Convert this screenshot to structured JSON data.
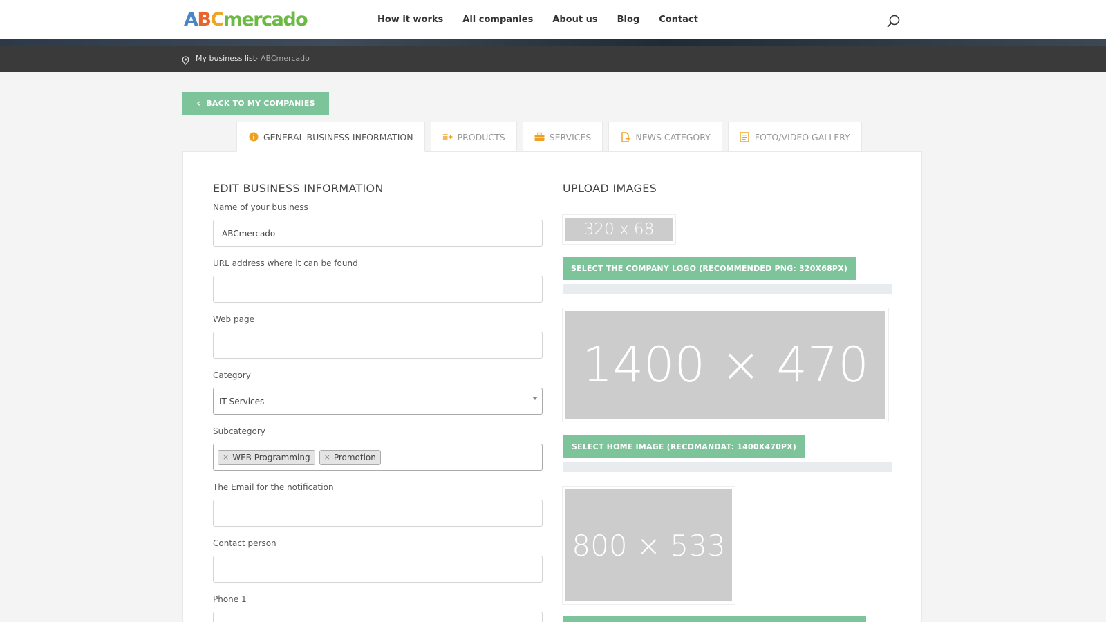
{
  "header": {
    "logo": {
      "a": "A",
      "b": "B",
      "c": "C",
      "rest": "mercado"
    },
    "nav": [
      "How it works",
      "All companies",
      "About us",
      "Blog",
      "Contact"
    ],
    "search_icon": "search-icon"
  },
  "breadcrumb": {
    "link": "My business list",
    "separator": "›",
    "current": "ABCmercado"
  },
  "back_button": {
    "label": "BACK TO MY COMPANIES"
  },
  "tabs": [
    {
      "label": "GENERAL BUSINESS INFORMATION",
      "icon": "info-icon",
      "active": true
    },
    {
      "label": "PRODUCTS",
      "icon": "list-add-icon",
      "active": false
    },
    {
      "label": "SERVICES",
      "icon": "briefcase-icon",
      "active": false
    },
    {
      "label": "NEWS CATEGORY",
      "icon": "document-add-icon",
      "active": false
    },
    {
      "label": "FOTO/VIDEO GALLERY",
      "icon": "gallery-icon",
      "active": false
    }
  ],
  "edit": {
    "title": "EDIT BUSINESS INFORMATION",
    "fields": {
      "name": {
        "label": "Name of your business",
        "value": "ABCmercado"
      },
      "url": {
        "label": "URL address where it can be found",
        "value": ""
      },
      "web": {
        "label": "Web page",
        "value": ""
      },
      "category": {
        "label": "Category",
        "value": "IT Services"
      },
      "subcategory": {
        "label": "Subcategory",
        "tags": [
          "WEB Programming",
          "Promotion"
        ],
        "remove": "×"
      },
      "email": {
        "label": "The Email for the notification",
        "value": ""
      },
      "contact": {
        "label": "Contact person",
        "value": ""
      },
      "phone": {
        "label": "Phone 1",
        "value": ""
      }
    }
  },
  "upload": {
    "title": "UPLOAD IMAGES",
    "logo": {
      "placeholder": "320 x 68",
      "button": "SELECT THE COMPANY LOGO (RECOMMENDED PNG: 320X68PX)",
      "progress": 0
    },
    "home": {
      "placeholder": "1400 × 470",
      "button": "SELECT HOME IMAGE (RECOMANDAT: 1400X470PX)",
      "progress": 0
    },
    "third": {
      "placeholder": "800 × 533"
    }
  },
  "colors": {
    "accent_green": "#7ec49a",
    "breadcrumb_bg": "#3a3a3a",
    "placeholder_gray": "#cccccc"
  }
}
